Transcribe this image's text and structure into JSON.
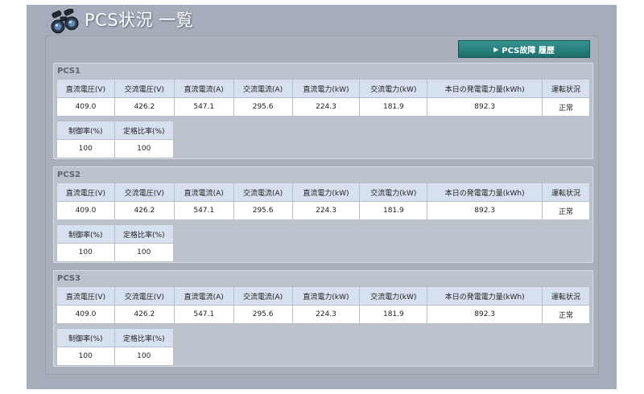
{
  "title": "PCS状況 一覧",
  "fault_history_button": "PCS故障 履歴",
  "headers_main": [
    "直流電圧(V)",
    "交流電圧(V)",
    "直流電流(A)",
    "交流電流(A)",
    "直流電力(kW)",
    "交流電力(kW)",
    "本日の発電電力量(kWh)",
    "運転状況"
  ],
  "headers_sub": [
    "制御率(%)",
    "定格比率(%)"
  ],
  "pcs": [
    {
      "name": "PCS1",
      "values": [
        "409.0",
        "426.2",
        "547.1",
        "295.6",
        "224.3",
        "181.9",
        "892.3",
        "正常"
      ],
      "sub_values": [
        "100",
        "100"
      ]
    },
    {
      "name": "PCS2",
      "values": [
        "409.0",
        "426.2",
        "547.1",
        "295.6",
        "224.3",
        "181.9",
        "892.3",
        "正常"
      ],
      "sub_values": [
        "100",
        "100"
      ]
    },
    {
      "name": "PCS3",
      "values": [
        "409.0",
        "426.2",
        "547.1",
        "295.6",
        "224.3",
        "181.9",
        "892.3",
        "正常"
      ],
      "sub_values": [
        "100",
        "100"
      ]
    }
  ],
  "colors": {
    "frame_bg": "#a6adba",
    "panel_bg": "#bcc3cd",
    "header_cell": "#d6e0ef",
    "button": "#1d6f6b"
  },
  "icons": {
    "title_icon": "binoculars-icon",
    "button_icon": "triangle-right-icon"
  }
}
